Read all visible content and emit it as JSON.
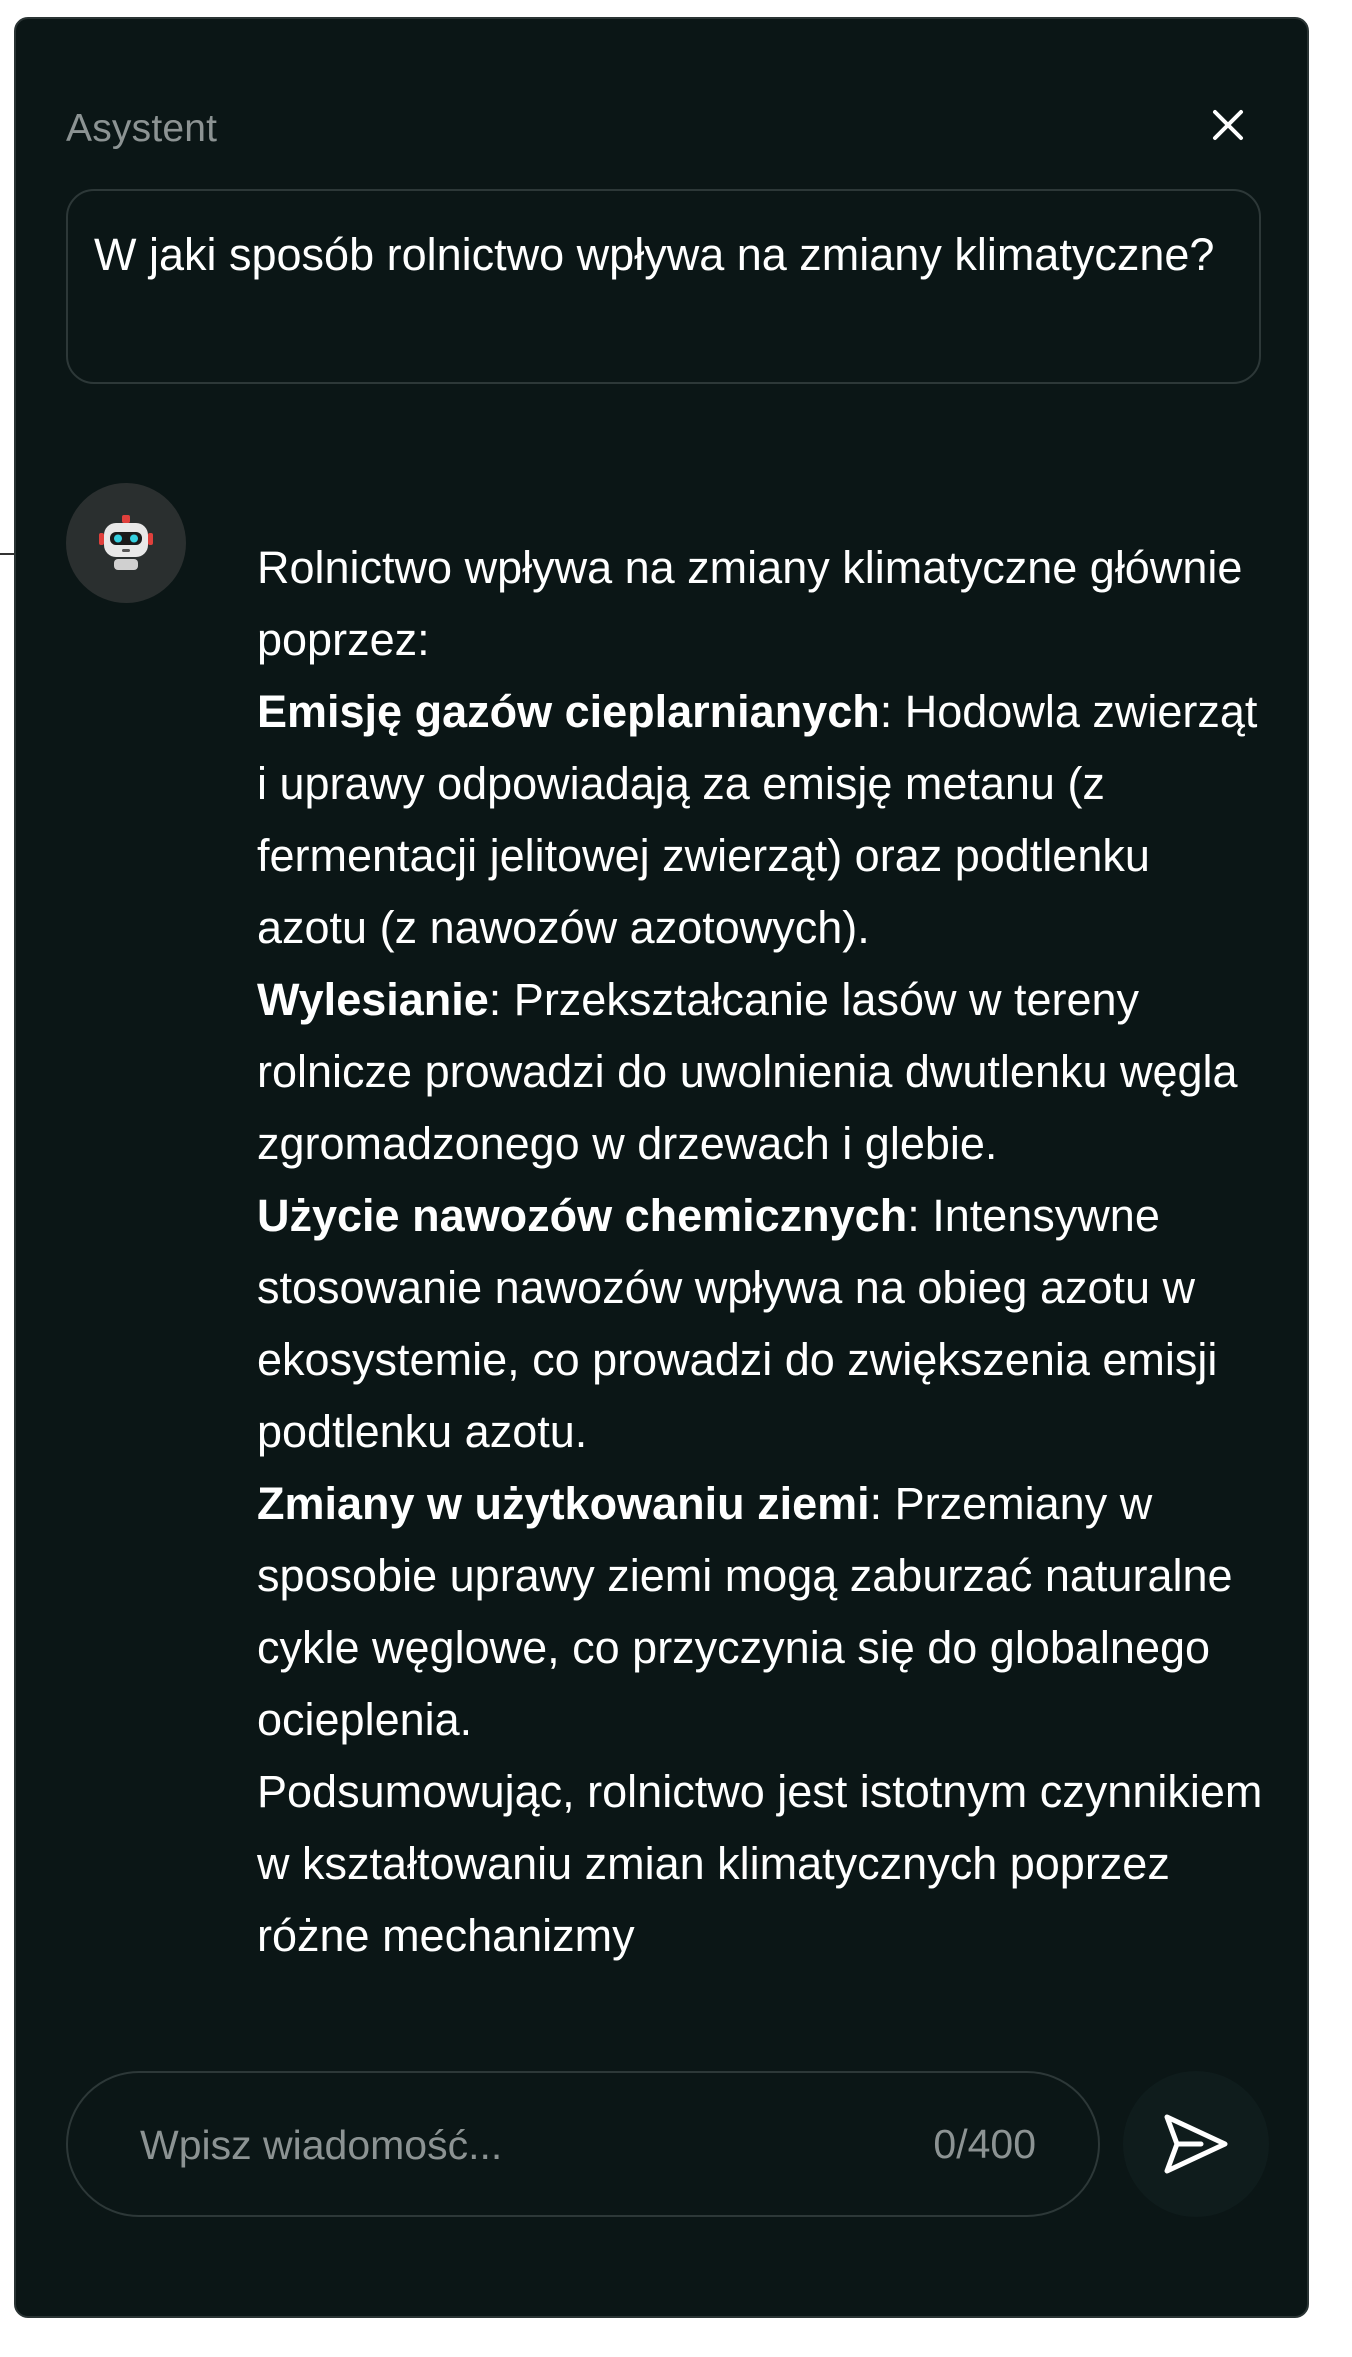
{
  "header": {
    "title": "Asystent",
    "close_icon": "close-icon"
  },
  "conversation": {
    "user_message": "W jaki sposób rolnictwo wpływa na zmiany klimatyczne?",
    "assistant_avatar_icon": "robot-icon",
    "assistant_message": {
      "intro": "Rolnictwo wpływa na zmiany klimatyczne głównie poprzez:",
      "points": [
        {
          "title": "Emisję gazów cieplarnianych",
          "text": ": Hodowla zwierząt i uprawy odpowiadają za emisję metanu (z fermentacji jelitowej zwierząt) oraz podtlenku azotu (z nawozów azotowych)."
        },
        {
          "title": "Wylesianie",
          "text": ": Przekształcanie lasów w tereny rolnicze prowadzi do uwolnienia dwutlenku węgla zgromadzonego w drzewach i glebie."
        },
        {
          "title": "Użycie nawozów chemicznych",
          "text": ": Intensywne stosowanie nawozów wpływa na obieg azotu w ekosystemie, co prowadzi do zwiększenia emisji podtlenku azotu."
        },
        {
          "title": "Zmiany w użytkowaniu ziemi",
          "text": ": Przemiany w sposobie uprawy ziemi mogą zaburzać naturalne cykle węglowe, co przyczynia się do globalnego ocieplenia."
        }
      ],
      "summary": "Podsumowując, rolnictwo jest istotnym czynnikiem w kształtowaniu zmian klimatycznych poprzez różne mechanizmy"
    }
  },
  "composer": {
    "placeholder": "Wpisz wiadomość...",
    "value": "",
    "counter": "0/400",
    "send_icon": "send-icon"
  },
  "colors": {
    "panel_background": "#0b1616",
    "muted_text": "#8c9393",
    "text": "#ffffff"
  }
}
